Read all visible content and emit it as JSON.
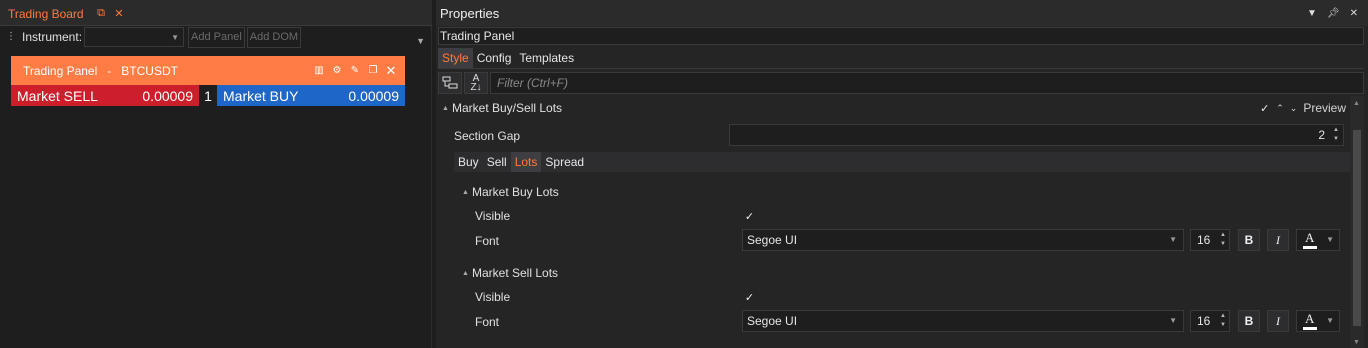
{
  "trading_board": {
    "tab_title": "Trading Board",
    "instrument_label": "Instrument:",
    "instrument_value": "",
    "add_panel": "Add Panel",
    "add_dom": "Add DOM",
    "panel": {
      "title": "Trading Panel",
      "separator": "-",
      "symbol": "BTCUSDT",
      "sell_label": "Market SELL",
      "sell_value": "0.00009",
      "lots": "1",
      "buy_label": "Market BUY",
      "buy_value": "0.00009"
    }
  },
  "properties": {
    "title": "Properties",
    "object": "Trading Panel",
    "tabs": [
      "Style",
      "Config",
      "Templates"
    ],
    "active_tab": "Style",
    "filter_placeholder": "Filter (Ctrl+F)",
    "section": {
      "title": "Market Buy/Sell Lots",
      "preview_label": "Preview",
      "preview_checked": true
    },
    "section_gap": {
      "label": "Section Gap",
      "value": "2"
    },
    "subtabs": [
      "Buy",
      "Sell",
      "Lots",
      "Spread"
    ],
    "active_subtab": "Lots",
    "groups": [
      {
        "title": "Market Buy Lots",
        "visible_label": "Visible",
        "visible": true,
        "font_label": "Font",
        "font_name": "Segoe UI",
        "font_size": "16",
        "bold": "B",
        "italic": "I",
        "color_glyph": "A",
        "color": "#ffffff"
      },
      {
        "title": "Market Sell Lots",
        "visible_label": "Visible",
        "visible": true,
        "font_label": "Font",
        "font_name": "Segoe UI",
        "font_size": "16",
        "bold": "B",
        "italic": "I",
        "color_glyph": "A",
        "color": "#ffffff"
      }
    ]
  },
  "colors": {
    "accent": "#ff7a3c",
    "panel_header": "#ff7d45",
    "sell": "#cc1f2b",
    "buy": "#1e66c8"
  }
}
